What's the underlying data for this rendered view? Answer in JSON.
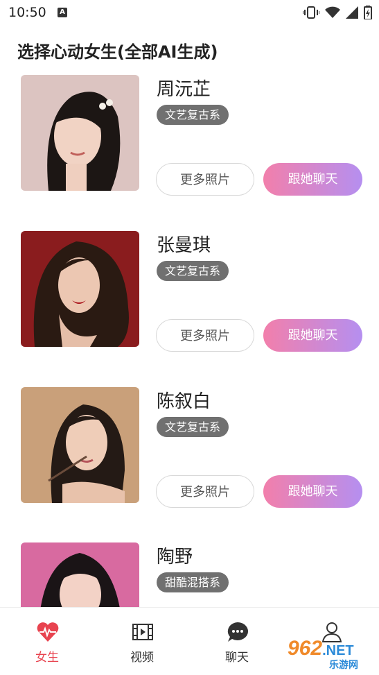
{
  "status_bar": {
    "time": "10:50",
    "notification_letter": "A"
  },
  "page_title": "选择心动女生(全部AI生成)",
  "buttons": {
    "more_photos": "更多照片",
    "chat_with_her": "跟她聊天"
  },
  "girls": [
    {
      "name": "周沅芷",
      "tag": "文艺复古系"
    },
    {
      "name": "张曼琪",
      "tag": "文艺复古系"
    },
    {
      "name": "陈叙白",
      "tag": "文艺复古系"
    },
    {
      "name": "陶野",
      "tag": "甜酷混搭系"
    }
  ],
  "tabs": [
    {
      "label": "女生",
      "icon": "heart-pulse-icon",
      "active": true
    },
    {
      "label": "视频",
      "icon": "film-icon",
      "active": false
    },
    {
      "label": "聊天",
      "icon": "chat-bubble-icon",
      "active": false
    },
    {
      "label": "",
      "icon": "person-icon",
      "active": false
    }
  ],
  "watermark": {
    "number": "962",
    "net": ".NET",
    "site": "乐游网"
  },
  "colors": {
    "accent_red": "#e8434f",
    "chat_gradient_start": "#f27fab",
    "chat_gradient_end": "#b58ff0",
    "tag_bg": "#707070"
  }
}
